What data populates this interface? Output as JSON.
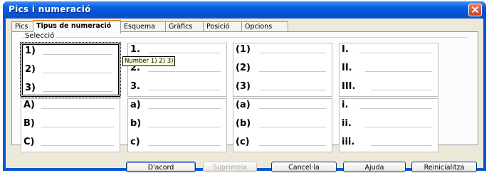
{
  "window": {
    "title": "Pics i numeració"
  },
  "tabs": [
    {
      "label": "Pics"
    },
    {
      "label": "Tipus de numeració",
      "active": true
    },
    {
      "label": "Esquema"
    },
    {
      "label": "Gràfics"
    },
    {
      "label": "Posició"
    },
    {
      "label": "Opcions"
    }
  ],
  "group": {
    "label": "Selecció"
  },
  "tooltip": "Number 1) 2) 3)",
  "grid": [
    {
      "items": [
        "1)",
        "2)",
        "3)"
      ],
      "selected": true
    },
    {
      "items": [
        "1.",
        "2.",
        "3."
      ]
    },
    {
      "items": [
        "(1)",
        "(2)",
        "(3)"
      ]
    },
    {
      "items": [
        "I.",
        "II.",
        "III."
      ]
    },
    {
      "items": [
        "A)",
        "B)",
        "C)"
      ]
    },
    {
      "items": [
        "a)",
        "b)",
        "c)"
      ]
    },
    {
      "items": [
        "(a)",
        "(b)",
        "(c)"
      ]
    },
    {
      "items": [
        "i.",
        "ii.",
        "iii."
      ]
    }
  ],
  "buttons": {
    "ok": "D'acord",
    "delete": "Suprimeix",
    "cancel": "Cancel·la",
    "help": "Ajuda",
    "reset": "Reinicialitza"
  },
  "colors": {
    "titlebar": "#0a57d6",
    "client": "#ece9d8",
    "close": "#c7431f"
  }
}
